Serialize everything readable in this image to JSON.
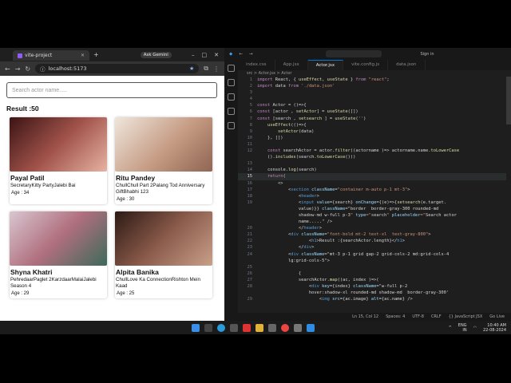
{
  "browser": {
    "tab_title": "vite-project",
    "ask_gemini": "Ask Gemini",
    "url": "localhost:5173",
    "search_placeholder": "Search actor name.....",
    "result_label": "Result :50",
    "cards": [
      {
        "name": "Payal Patil",
        "shows": "SecretaryKitty PartyJalebi Bai",
        "age": "Age : 34",
        "photo": "#6b2a2a"
      },
      {
        "name": "Ritu Pandey",
        "shows": "ChullChull Part 2Palang Tod Anniversary GiftBhabhi 123",
        "age": "Age : 30",
        "photo": "#b89a86"
      },
      {
        "name": "Shyna Khatri",
        "shows": "PehredaarPaglet 2KarzdaarMalaiJalebi Season 4",
        "age": "Age : 29",
        "photo": "#a06a7a"
      },
      {
        "name": "Alpita Banika",
        "shows": "ChullLove Ka ConnectionRishton Mein Kaad",
        "age": "Age : 25",
        "photo": "#5a3a30"
      }
    ]
  },
  "vscode": {
    "sign_in": "Sign in",
    "tabs": [
      "index.css",
      "App.jsx",
      "Actor.jsx",
      "vite.config.js",
      "data.json"
    ],
    "active_tab": "Actor.jsx",
    "breadcrumb": "src > Actor.jsx > Actor",
    "lines": [
      {
        "n": "1",
        "t": "import React, { useEffect, useState } from \"react\";"
      },
      {
        "n": "2",
        "t": "import data from './data.json'"
      },
      {
        "n": "3",
        "t": ""
      },
      {
        "n": "4",
        "t": ""
      },
      {
        "n": "5",
        "t": "const Actor = ()=>{"
      },
      {
        "n": "6",
        "t": "const [actor , setActor] = useState([])"
      },
      {
        "n": "7",
        "t": "const [search , setsearch ] = useState('')"
      },
      {
        "n": "8",
        "t": "    useEffect(()=>{"
      },
      {
        "n": "9",
        "t": "        setActor(data)"
      },
      {
        "n": "10",
        "t": "    }, [])"
      },
      {
        "n": "11",
        "t": ""
      },
      {
        "n": "12",
        "t": "    const searchActor = actor.filter((actorname )=> actorname.name.toLowerCase"
      },
      {
        "n": "",
        "t": "    ().includes(search.toLowerCase()))"
      },
      {
        "n": "13",
        "t": ""
      },
      {
        "n": "14",
        "t": "    console.log(search)"
      },
      {
        "n": "15",
        "t": "    return("
      },
      {
        "n": "16",
        "t": "        <>"
      },
      {
        "n": "17",
        "t": "            <section className=\"container m-auto p-1 mt-3\">"
      },
      {
        "n": "18",
        "t": "                <header>"
      },
      {
        "n": "19",
        "t": "                <input value={search} onChange={(e)=>{setsearch(e.target."
      },
      {
        "n": "",
        "t": "                value)}} className=\"border  border-gray-300 rounded-md"
      },
      {
        "n": "",
        "t": "                shadow-md w-full p-3\" type=\"search\" placeholder=\"Search actor"
      },
      {
        "n": "",
        "t": "                name.....\" />"
      },
      {
        "n": "20",
        "t": "                </header>"
      },
      {
        "n": "21",
        "t": "            <div className=\"font-bold mt-2 text-xl  text-gray-800\">"
      },
      {
        "n": "22",
        "t": "                    <h1>Result :{searchActor.length}</h1>"
      },
      {
        "n": "23",
        "t": "                </div>"
      },
      {
        "n": "24",
        "t": "            <div className=\"mt-3 p-1 grid gap-2 grid-cols-2 md:grid-cols-4"
      },
      {
        "n": "",
        "t": "            lg:grid-cols-5\">"
      },
      {
        "n": "25",
        "t": ""
      },
      {
        "n": "26",
        "t": "                {"
      },
      {
        "n": "27",
        "t": "                searchActor.map((ac, index )=>("
      },
      {
        "n": "28",
        "t": "                    <div key={index} className=\"w-full p-2"
      },
      {
        "n": "",
        "t": "                    hover:shadow-xl rounded-md shadow-md  border-gray-300'"
      },
      {
        "n": "29",
        "t": "                        <img src={ac.image} alt={ac.name} />"
      }
    ],
    "status": [
      "Ln 15, Col 12",
      "Spaces: 4",
      "UTF-8",
      "CRLF",
      "{} JavaScript JSX",
      "Go Live"
    ]
  },
  "taskbar": {
    "lang_top": "ENG",
    "lang_bottom": "IN",
    "time": "10:40 AM",
    "date": "22-08-2024"
  }
}
